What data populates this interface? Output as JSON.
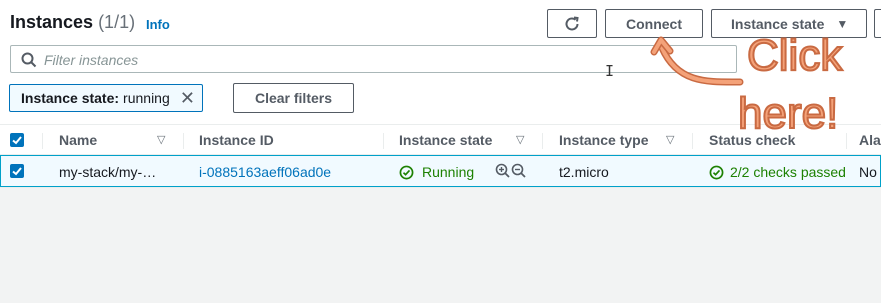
{
  "header": {
    "title": "Instances",
    "count": "(1/1)",
    "info": "Info",
    "connect_label": "Connect",
    "instance_state_label": "Instance state"
  },
  "filter": {
    "placeholder": "Filter instances",
    "token_key": "Instance state:",
    "token_value": "running",
    "clear_label": "Clear filters"
  },
  "table": {
    "columns": [
      "Name",
      "Instance ID",
      "Instance state",
      "Instance type",
      "Status check",
      "Ala"
    ],
    "rows": [
      {
        "name": "my-stack/my-…",
        "instance_id": "i-0885163aeff06ad0e",
        "state": "Running",
        "type": "t2.micro",
        "status": "2/2 checks passed",
        "alarm": "No"
      }
    ]
  },
  "annotation": {
    "line1": "Click",
    "line2": "here!"
  },
  "colors": {
    "link": "#0073bb",
    "success": "#1d8102",
    "selected_row_bg": "#f1faff",
    "annotation": "#f4a279"
  }
}
